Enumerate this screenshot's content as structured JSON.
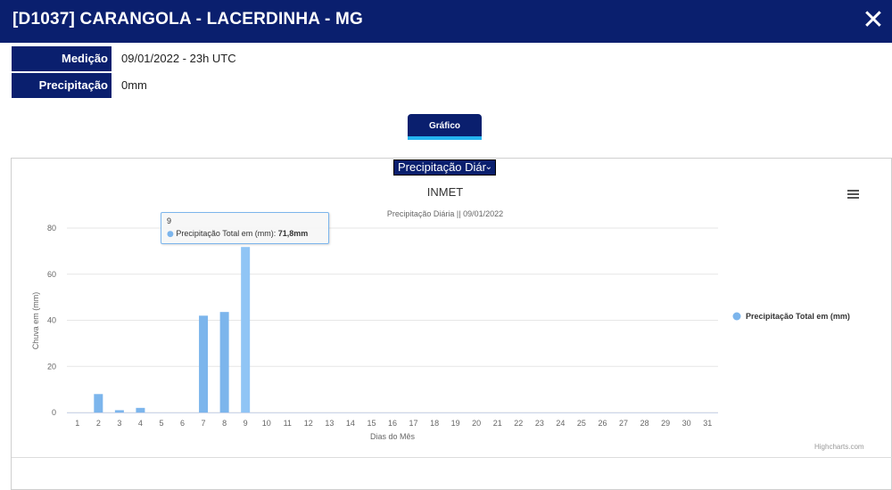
{
  "header": {
    "title": "[D1037] CARANGOLA - LACERDINHA - MG",
    "close_icon": "close-icon"
  },
  "info": {
    "medicao_label": "Medição",
    "medicao_value": "09/01/2022 - 23h UTC",
    "precipitacao_label": "Precipitação",
    "precipitacao_value": "0mm"
  },
  "grafico_button": "Gráfico",
  "series_select": {
    "selected": "Precipitação Diár",
    "chevron_icon": "chevron-down-icon"
  },
  "menu_icon": "hamburger-menu-icon",
  "tooltip": {
    "x": "9",
    "series": "Precipitação Total em (mm):",
    "value": "71,8mm"
  },
  "credits": "Highcharts.com",
  "colors": {
    "header_bg": "#0a1f6e",
    "accent": "#25b4f0",
    "bar": "#7cb5ec",
    "bar_hover": "#90c5f5"
  },
  "chart_data": {
    "type": "bar",
    "title": "INMET",
    "subtitle": "Precipitação Diária || 09/01/2022",
    "xlabel": "Dias do Mês",
    "ylabel": "Chuva em (mm)",
    "ylim": [
      0,
      80
    ],
    "yticks": [
      "0",
      "20",
      "40",
      "60",
      "80"
    ],
    "grid": true,
    "legend_position": "right",
    "categories": [
      "1",
      "2",
      "3",
      "4",
      "5",
      "6",
      "7",
      "8",
      "9",
      "10",
      "11",
      "12",
      "13",
      "14",
      "15",
      "16",
      "17",
      "18",
      "19",
      "20",
      "21",
      "22",
      "23",
      "24",
      "25",
      "26",
      "27",
      "28",
      "29",
      "30",
      "31"
    ],
    "series": [
      {
        "name": "Precipitação Total em (mm)",
        "values": [
          0,
          8,
          1,
          2,
          0,
          0,
          42,
          43.6,
          71.8,
          null,
          null,
          null,
          null,
          null,
          null,
          null,
          null,
          null,
          null,
          null,
          null,
          null,
          null,
          null,
          null,
          null,
          null,
          null,
          null,
          null,
          null
        ]
      }
    ],
    "highlighted_index": 8
  }
}
